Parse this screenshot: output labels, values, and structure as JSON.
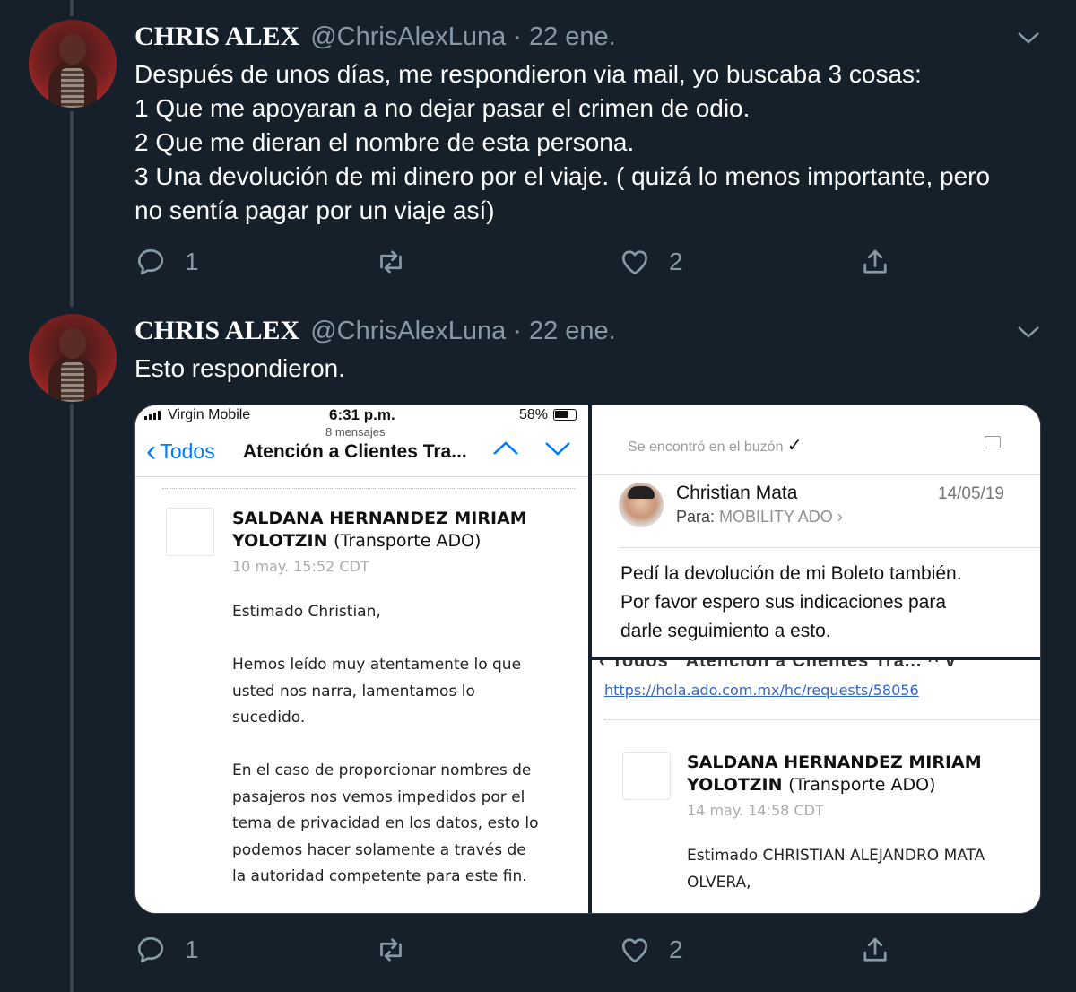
{
  "tweets": [
    {
      "name": "CHRIS ALEX",
      "handle": "@ChrisAlexLuna",
      "separator": "·",
      "time": "22 ene.",
      "lines": [
        "Después de unos días, me respondieron via mail, yo buscaba 3 cosas:",
        "1 Que me apoyaran a no dejar pasar el crimen de odio.",
        "2 Que me dieran el nombre de esta persona.",
        "3 Una devolución de mi dinero por el viaje. ( quizá lo menos importante, pero",
        "no sentía pagar por un viaje así)"
      ],
      "reply_count": "1",
      "like_count": "2"
    },
    {
      "name": "CHRIS ALEX",
      "handle": "@ChrisAlexLuna",
      "separator": "·",
      "time": "22 ene.",
      "lines": [
        "Esto respondieron."
      ],
      "reply_count": "1",
      "like_count": "2"
    }
  ],
  "media": {
    "left": {
      "carrier": "Virgin Mobile",
      "clock": "6:31 p.m.",
      "battery": "58%",
      "message_count": "8 mensajes",
      "back_label": "Todos",
      "title": "Atención a Clientes Tra...",
      "sender_name": "SALDANA HERNANDEZ MIRIAM",
      "sender_name2": "YOLOTZIN",
      "sender_org": "(Transporte ADO)",
      "date": "10 may. 15:52 CDT",
      "greeting": "Estimado Christian,",
      "para1": [
        "Hemos leído muy atentamente lo que",
        "usted nos narra, lamentamos lo",
        "sucedido."
      ],
      "para2": [
        "En el caso de proporcionar nombres de",
        "pasajeros nos vemos impedidos por el",
        "tema de privacidad en los datos, esto lo",
        "podemos hacer solamente a través de",
        "la autoridad competente para este fin."
      ]
    },
    "right_top": {
      "found_label": "Se encontró en el buzón",
      "sender": "Christian Mata",
      "date": "14/05/19",
      "to_label": "Para:",
      "to_value": "MOBILITY ADO",
      "body": [
        "Pedí la devolución de mi Boleto también.",
        "Por favor espero sus indicaciones para",
        "darle seguimiento a esto."
      ]
    },
    "right_bottom": {
      "link": "https://hola.ado.com.mx/hc/requests/58056",
      "sender_name": "SALDANA HERNANDEZ MIRIAM",
      "sender_name2": "YOLOTZIN",
      "sender_org": "(Transporte ADO)",
      "date": "14 may. 14:58 CDT",
      "greeting": [
        "Estimado CHRISTIAN ALEJANDRO MATA",
        "OLVERA,"
      ]
    }
  },
  "icons": {
    "reply": "reply-icon",
    "retweet": "retweet-icon",
    "like": "heart-icon",
    "share": "share-icon",
    "caret": "chevron-down-icon"
  },
  "colors": {
    "background": "#15202b",
    "secondary_text": "#8899a6",
    "thread_line": "#38444d",
    "ios_blue": "#007aff",
    "link": "#3366cc"
  }
}
